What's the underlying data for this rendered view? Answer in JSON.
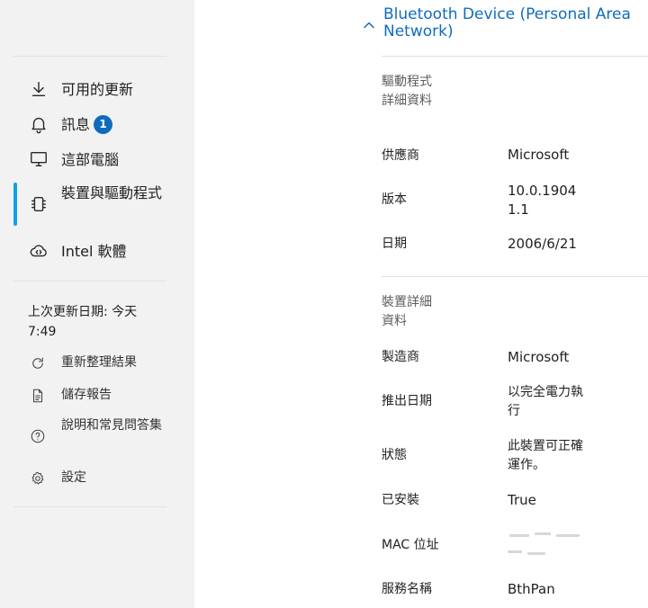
{
  "sidebar": {
    "nav": [
      {
        "label": "可用的更新",
        "icon": "download-icon"
      },
      {
        "label": "訊息",
        "icon": "bell-icon",
        "badge": "1"
      },
      {
        "label": "這部電腦",
        "icon": "monitor-icon"
      },
      {
        "label": "裝置與驅動程式",
        "icon": "chip-icon",
        "selected": true
      },
      {
        "label": "Intel 軟體",
        "icon": "cloud-code-icon"
      }
    ],
    "last_update": "上次更新日期: 今天 7:49",
    "actions": [
      {
        "label": "重新整理結果",
        "icon": "refresh-icon"
      },
      {
        "label": "儲存報告",
        "icon": "document-icon"
      },
      {
        "label": "說明和常見問答集",
        "icon": "help-icon"
      },
      {
        "label": "設定",
        "icon": "gear-icon"
      }
    ],
    "accent_color": "#0fa3e9"
  },
  "main": {
    "section_title": "Bluetooth Device (Personal Area Network)",
    "driver_details": {
      "heading": "驅動程式詳細資料",
      "rows": [
        {
          "label": "供應商",
          "value": "Microsoft"
        },
        {
          "label": "版本",
          "value": "10.0.19041.1"
        },
        {
          "label": "日期",
          "value": "2006/6/21"
        }
      ]
    },
    "device_details": {
      "heading": "裝置詳細資料",
      "rows": [
        {
          "label": "製造商",
          "value": "Microsoft"
        },
        {
          "label": "推出日期",
          "value": "以完全電力執行"
        },
        {
          "label": "狀態",
          "value": "此裝置可正確運作。"
        },
        {
          "label": "已安裝",
          "value": "True"
        },
        {
          "label": "MAC 位址",
          "value": ""
        },
        {
          "label": "服務名稱",
          "value": "BthPan"
        }
      ]
    },
    "accent_color": "#0f6cbd"
  }
}
